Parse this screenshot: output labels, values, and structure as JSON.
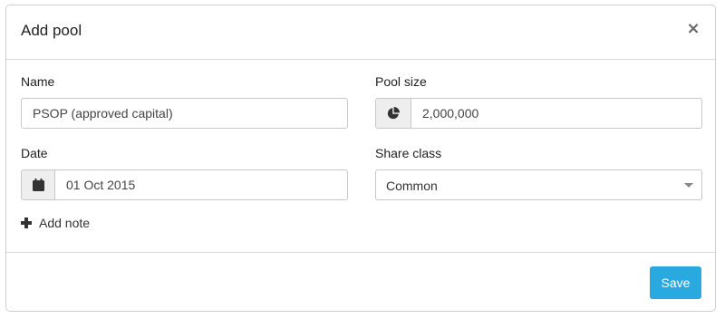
{
  "modal": {
    "title": "Add pool",
    "close_symbol": "×"
  },
  "form": {
    "name": {
      "label": "Name",
      "value": "PSOP (approved capital)"
    },
    "pool_size": {
      "label": "Pool size",
      "value": "2,000,000",
      "icon": "pie-chart-icon"
    },
    "date": {
      "label": "Date",
      "value": "01 Oct 2015",
      "icon": "calendar-icon"
    },
    "share_class": {
      "label": "Share class",
      "value": "Common"
    },
    "add_note_label": "Add note"
  },
  "footer": {
    "save_label": "Save"
  },
  "colors": {
    "primary_button": "#29a9e0",
    "border": "#c8c8c8",
    "addon_background": "#eeeeee"
  }
}
